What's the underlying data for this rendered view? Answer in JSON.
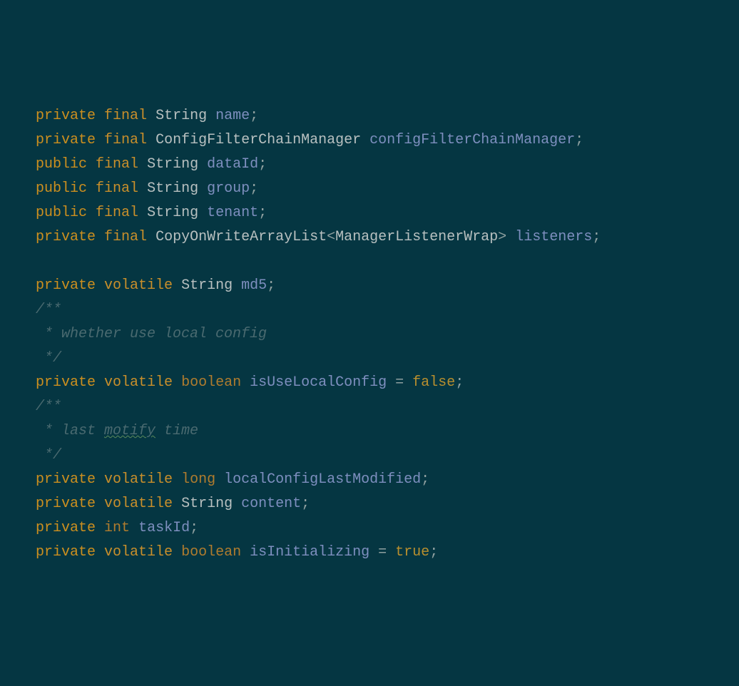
{
  "lines": [
    {
      "type": "decl",
      "tokens": [
        {
          "cls": "kw-access",
          "t": "private"
        },
        {
          "cls": "sp",
          "t": " "
        },
        {
          "cls": "kw-mod",
          "t": "final"
        },
        {
          "cls": "sp",
          "t": " "
        },
        {
          "cls": "kw-type",
          "t": "String"
        },
        {
          "cls": "sp",
          "t": " "
        },
        {
          "cls": "ident",
          "t": "name"
        },
        {
          "cls": "punct",
          "t": ";"
        }
      ]
    },
    {
      "type": "decl",
      "tokens": [
        {
          "cls": "kw-access",
          "t": "private"
        },
        {
          "cls": "sp",
          "t": " "
        },
        {
          "cls": "kw-mod",
          "t": "final"
        },
        {
          "cls": "sp",
          "t": " "
        },
        {
          "cls": "kw-type",
          "t": "ConfigFilterChainManager"
        },
        {
          "cls": "sp",
          "t": " "
        },
        {
          "cls": "ident",
          "t": "configFilterChainManager"
        },
        {
          "cls": "punct",
          "t": ";"
        }
      ]
    },
    {
      "type": "decl",
      "tokens": [
        {
          "cls": "kw-access",
          "t": "public"
        },
        {
          "cls": "sp",
          "t": " "
        },
        {
          "cls": "kw-mod",
          "t": "final"
        },
        {
          "cls": "sp",
          "t": " "
        },
        {
          "cls": "kw-type",
          "t": "String"
        },
        {
          "cls": "sp",
          "t": " "
        },
        {
          "cls": "ident",
          "t": "dataId"
        },
        {
          "cls": "punct",
          "t": ";"
        }
      ]
    },
    {
      "type": "decl",
      "tokens": [
        {
          "cls": "kw-access",
          "t": "public"
        },
        {
          "cls": "sp",
          "t": " "
        },
        {
          "cls": "kw-mod",
          "t": "final"
        },
        {
          "cls": "sp",
          "t": " "
        },
        {
          "cls": "kw-type",
          "t": "String"
        },
        {
          "cls": "sp",
          "t": " "
        },
        {
          "cls": "ident",
          "t": "group"
        },
        {
          "cls": "punct",
          "t": ";"
        }
      ]
    },
    {
      "type": "decl",
      "tokens": [
        {
          "cls": "kw-access",
          "t": "public"
        },
        {
          "cls": "sp",
          "t": " "
        },
        {
          "cls": "kw-mod",
          "t": "final"
        },
        {
          "cls": "sp",
          "t": " "
        },
        {
          "cls": "kw-type",
          "t": "String"
        },
        {
          "cls": "sp",
          "t": " "
        },
        {
          "cls": "ident",
          "t": "tenant"
        },
        {
          "cls": "punct",
          "t": ";"
        }
      ]
    },
    {
      "type": "decl",
      "tokens": [
        {
          "cls": "kw-access",
          "t": "private"
        },
        {
          "cls": "sp",
          "t": " "
        },
        {
          "cls": "kw-mod",
          "t": "final"
        },
        {
          "cls": "sp",
          "t": " "
        },
        {
          "cls": "kw-type",
          "t": "CopyOnWriteArrayList"
        },
        {
          "cls": "punct",
          "t": "<"
        },
        {
          "cls": "kw-type",
          "t": "ManagerListenerWrap"
        },
        {
          "cls": "punct",
          "t": ">"
        },
        {
          "cls": "sp",
          "t": " "
        },
        {
          "cls": "ident",
          "t": "listeners"
        },
        {
          "cls": "punct",
          "t": ";"
        }
      ]
    },
    {
      "type": "blank",
      "tokens": [
        {
          "cls": "sp",
          "t": " "
        }
      ]
    },
    {
      "type": "decl",
      "tokens": [
        {
          "cls": "kw-access",
          "t": "private"
        },
        {
          "cls": "sp",
          "t": " "
        },
        {
          "cls": "kw-mod",
          "t": "volatile"
        },
        {
          "cls": "sp",
          "t": " "
        },
        {
          "cls": "kw-type",
          "t": "String"
        },
        {
          "cls": "sp",
          "t": " "
        },
        {
          "cls": "ident",
          "t": "md5"
        },
        {
          "cls": "punct",
          "t": ";"
        }
      ]
    },
    {
      "type": "comment",
      "tokens": [
        {
          "cls": "comment",
          "t": "/**"
        }
      ]
    },
    {
      "type": "comment",
      "tokens": [
        {
          "cls": "comment",
          "t": " * whether use local config"
        }
      ]
    },
    {
      "type": "comment",
      "tokens": [
        {
          "cls": "comment",
          "t": " */"
        }
      ]
    },
    {
      "type": "decl",
      "tokens": [
        {
          "cls": "kw-access",
          "t": "private"
        },
        {
          "cls": "sp",
          "t": " "
        },
        {
          "cls": "kw-mod",
          "t": "volatile"
        },
        {
          "cls": "sp",
          "t": " "
        },
        {
          "cls": "kw-prim",
          "t": "boolean"
        },
        {
          "cls": "sp",
          "t": " "
        },
        {
          "cls": "ident",
          "t": "isUseLocalConfig"
        },
        {
          "cls": "sp",
          "t": " "
        },
        {
          "cls": "punct",
          "t": "="
        },
        {
          "cls": "sp",
          "t": " "
        },
        {
          "cls": "kw-lit",
          "t": "false"
        },
        {
          "cls": "punct",
          "t": ";"
        }
      ]
    },
    {
      "type": "comment",
      "tokens": [
        {
          "cls": "comment",
          "t": "/**"
        }
      ]
    },
    {
      "type": "comment",
      "tokens": [
        {
          "cls": "comment",
          "t": " * last "
        },
        {
          "cls": "comment wavy",
          "t": "motify"
        },
        {
          "cls": "comment",
          "t": " time"
        }
      ]
    },
    {
      "type": "comment",
      "tokens": [
        {
          "cls": "comment",
          "t": " */"
        }
      ]
    },
    {
      "type": "decl",
      "tokens": [
        {
          "cls": "kw-access",
          "t": "private"
        },
        {
          "cls": "sp",
          "t": " "
        },
        {
          "cls": "kw-mod",
          "t": "volatile"
        },
        {
          "cls": "sp",
          "t": " "
        },
        {
          "cls": "kw-prim",
          "t": "long"
        },
        {
          "cls": "sp",
          "t": " "
        },
        {
          "cls": "ident",
          "t": "localConfigLastModified"
        },
        {
          "cls": "punct",
          "t": ";"
        }
      ]
    },
    {
      "type": "decl",
      "tokens": [
        {
          "cls": "kw-access",
          "t": "private"
        },
        {
          "cls": "sp",
          "t": " "
        },
        {
          "cls": "kw-mod",
          "t": "volatile"
        },
        {
          "cls": "sp",
          "t": " "
        },
        {
          "cls": "kw-type",
          "t": "String"
        },
        {
          "cls": "sp",
          "t": " "
        },
        {
          "cls": "ident",
          "t": "content"
        },
        {
          "cls": "punct",
          "t": ";"
        }
      ]
    },
    {
      "type": "decl",
      "tokens": [
        {
          "cls": "kw-access",
          "t": "private"
        },
        {
          "cls": "sp",
          "t": " "
        },
        {
          "cls": "kw-prim",
          "t": "int"
        },
        {
          "cls": "sp",
          "t": " "
        },
        {
          "cls": "ident",
          "t": "taskId"
        },
        {
          "cls": "punct",
          "t": ";"
        }
      ]
    },
    {
      "type": "decl",
      "tokens": [
        {
          "cls": "kw-access",
          "t": "private"
        },
        {
          "cls": "sp",
          "t": " "
        },
        {
          "cls": "kw-mod",
          "t": "volatile"
        },
        {
          "cls": "sp",
          "t": " "
        },
        {
          "cls": "kw-prim",
          "t": "boolean"
        },
        {
          "cls": "sp",
          "t": " "
        },
        {
          "cls": "ident",
          "t": "isInitializing"
        },
        {
          "cls": "sp",
          "t": " "
        },
        {
          "cls": "punct",
          "t": "="
        },
        {
          "cls": "sp",
          "t": " "
        },
        {
          "cls": "kw-lit",
          "t": "true"
        },
        {
          "cls": "punct",
          "t": ";"
        }
      ]
    }
  ]
}
